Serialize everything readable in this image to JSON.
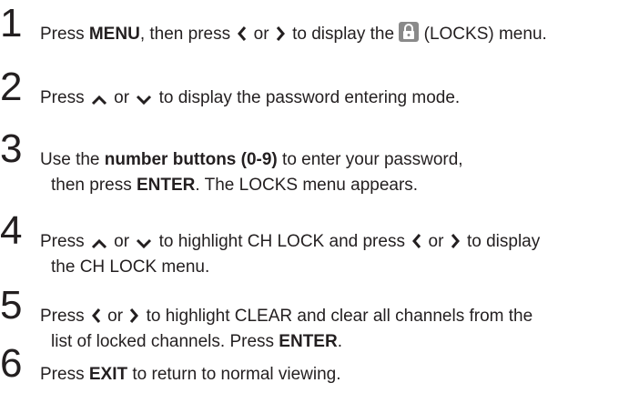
{
  "steps": [
    {
      "number": "1",
      "parts": {
        "t1": "Press ",
        "b1": "MENU",
        "t2": ", then press ",
        "t3": " or ",
        "t4": " to display the ",
        "t5": " (LOCKS) menu."
      }
    },
    {
      "number": "2",
      "parts": {
        "t1": "Press ",
        "t2": " or ",
        "t3": " to display the password entering mode."
      }
    },
    {
      "number": "3",
      "parts": {
        "t1": "Use the ",
        "b1": "number buttons (0-9)",
        "t2": " to enter your password,",
        "t3": "then press ",
        "b2": "ENTER",
        "t4": ". The LOCKS menu appears."
      }
    },
    {
      "number": "4",
      "parts": {
        "t1": "Press ",
        "t2": " or ",
        "t3": " to highlight CH LOCK and press ",
        "t4": " or ",
        "t5": " to display",
        "t6": "the CH LOCK menu."
      }
    },
    {
      "number": "5",
      "parts": {
        "t1": "Press ",
        "t2": " or ",
        "t3": " to highlight CLEAR and clear all channels from the",
        "t4": "list of locked channels. Press ",
        "b1": "ENTER",
        "t5": "."
      }
    },
    {
      "number": "6",
      "parts": {
        "t1": "Press ",
        "b1": "EXIT",
        "t2": " to return to normal viewing."
      }
    }
  ],
  "icons": {
    "left": "chevron-left-icon",
    "right": "chevron-right-icon",
    "up": "chevron-up-icon",
    "down": "chevron-down-icon",
    "locks": "padlock-icon"
  },
  "colors": {
    "text": "#231f20",
    "icon_bg": "#8a8a8a",
    "icon_fg": "#ffffff"
  }
}
